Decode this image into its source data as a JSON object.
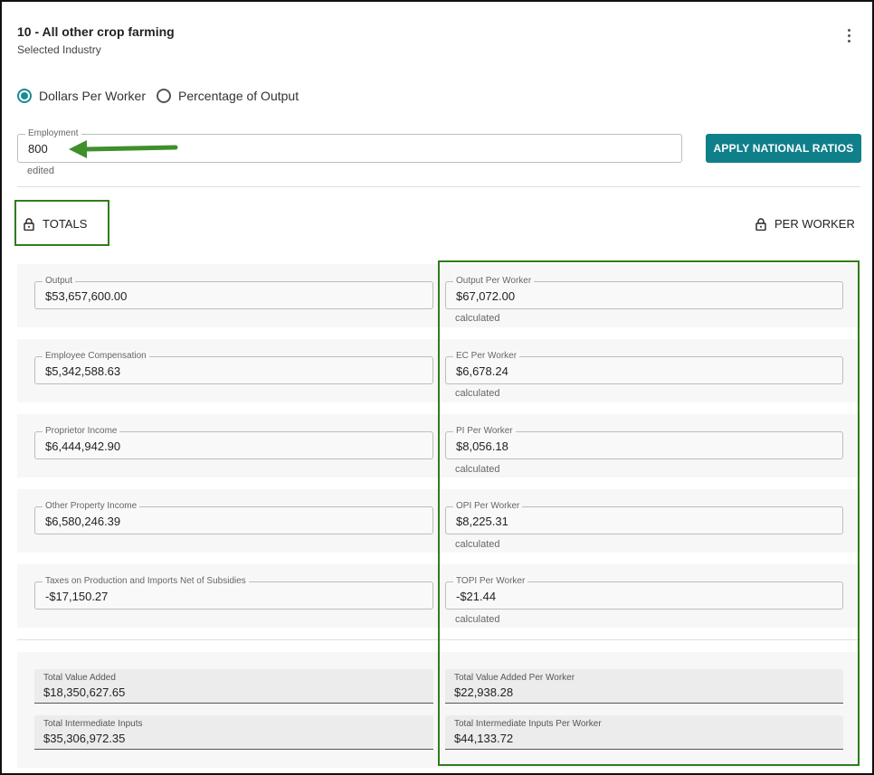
{
  "header": {
    "title": "10 - All other crop farming",
    "subtitle": "Selected Industry"
  },
  "mode": {
    "options": [
      {
        "label": "Dollars Per Worker",
        "checked": true
      },
      {
        "label": "Percentage of Output",
        "checked": false
      }
    ]
  },
  "employment": {
    "label": "Employment",
    "value": "800",
    "helper": "edited"
  },
  "apply_button": {
    "label": "APPLY NATIONAL RATIOS"
  },
  "toggles": {
    "totals": {
      "label": "TOTALS",
      "icon": "lock-icon"
    },
    "per_worker": {
      "label": "PER WORKER",
      "icon": "lock-icon"
    }
  },
  "rows": [
    {
      "total_label": "Output",
      "total_value": "$53,657,600.00",
      "pw_label": "Output Per Worker",
      "pw_value": "$67,072.00",
      "helper": "calculated"
    },
    {
      "total_label": "Employee Compensation",
      "total_value": "$5,342,588.63",
      "pw_label": "EC Per Worker",
      "pw_value": "$6,678.24",
      "helper": "calculated"
    },
    {
      "total_label": "Proprietor Income",
      "total_value": "$6,444,942.90",
      "pw_label": "PI Per Worker",
      "pw_value": "$8,056.18",
      "helper": "calculated"
    },
    {
      "total_label": "Other Property Income",
      "total_value": "$6,580,246.39",
      "pw_label": "OPI Per Worker",
      "pw_value": "$8,225.31",
      "helper": "calculated"
    },
    {
      "total_label": "Taxes on Production and Imports Net of Subsidies",
      "total_value": "-$17,150.27",
      "pw_label": "TOPI Per Worker",
      "pw_value": "-$21.44",
      "helper": "calculated"
    }
  ],
  "summary": [
    {
      "total_label": "Total Value Added",
      "total_value": "$18,350,627.65",
      "pw_label": "Total Value Added Per Worker",
      "pw_value": "$22,938.28"
    },
    {
      "total_label": "Total Intermediate Inputs",
      "total_value": "$35,306,972.35",
      "pw_label": "Total Intermediate Inputs Per Worker",
      "pw_value": "$44,133.72"
    }
  ],
  "colors": {
    "accent": "#0f7f8a",
    "radio": "#1a8a96",
    "annotation_green": "#2f7d1e",
    "arrow_green": "#3f8f2a"
  }
}
